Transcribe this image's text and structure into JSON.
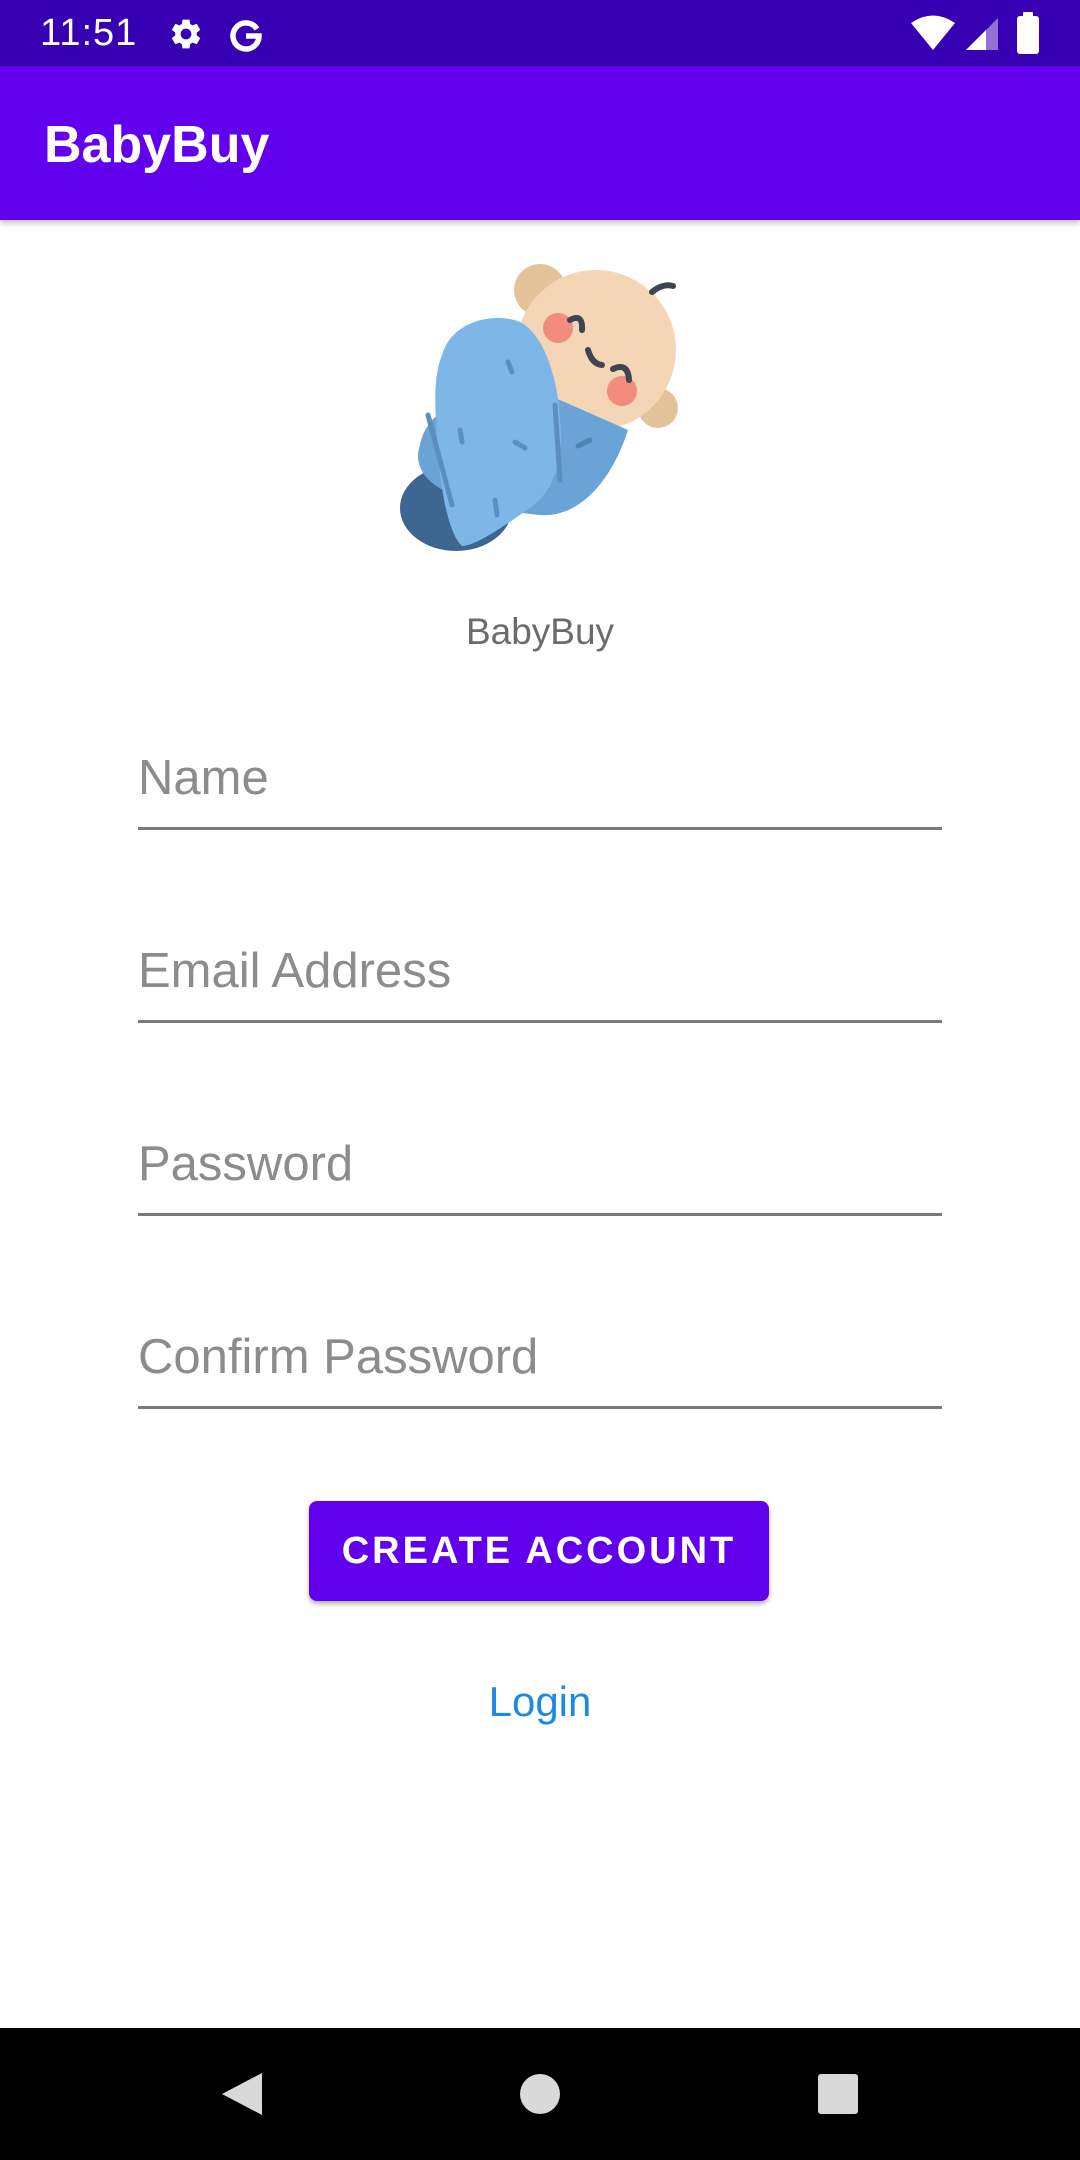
{
  "status_bar": {
    "time": "11:51",
    "left_icons": [
      "gear-icon",
      "google-g-icon"
    ],
    "right_icons": [
      "wifi-icon",
      "signal-icon",
      "battery-icon"
    ],
    "background": "#3700b3"
  },
  "app_bar": {
    "title": "BabyBuy",
    "background": "#6200ee"
  },
  "logo": {
    "icon": "swaddled-baby-icon",
    "caption": "BabyBuy"
  },
  "form": {
    "name_placeholder": "Name",
    "email_placeholder": "Email Address",
    "password_placeholder": "Password",
    "confirm_password_placeholder": "Confirm Password"
  },
  "actions": {
    "create_account_label": "CREATE ACCOUNT",
    "login_label": "Login"
  },
  "nav_bar": {
    "buttons": [
      "back-icon",
      "home-icon",
      "recents-icon"
    ]
  },
  "colors": {
    "accent": "#6200ee",
    "status_bar": "#3700b3",
    "link": "#1e88e5"
  }
}
